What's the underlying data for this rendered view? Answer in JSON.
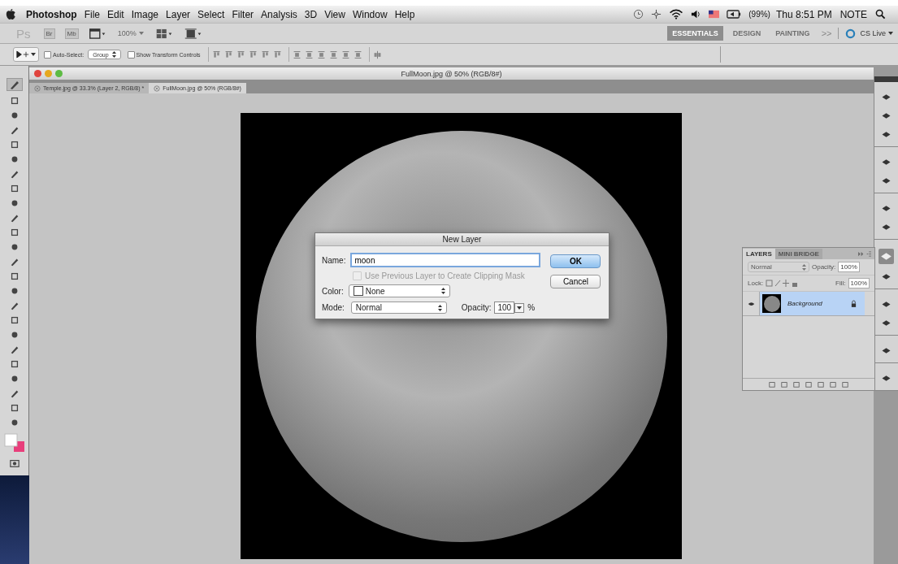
{
  "menubar": {
    "app": "Photoshop",
    "menus": [
      "File",
      "Edit",
      "Image",
      "Layer",
      "Select",
      "Filter",
      "Analysis",
      "3D",
      "View",
      "Window",
      "Help"
    ],
    "battery": "(99%)",
    "clock": "Thu 8:51 PM",
    "user": "NOTE"
  },
  "app_bar": {
    "logo": "Ps",
    "bridge": "Br",
    "mini_bridge": "Mb",
    "zoom": "100%",
    "workspaces": [
      {
        "label": "ESSENTIALS",
        "selected": true
      },
      {
        "label": "DESIGN",
        "selected": false
      },
      {
        "label": "PAINTING",
        "selected": false
      }
    ],
    "more": ">>",
    "cs_live": "CS Live"
  },
  "options_bar": {
    "auto_select": {
      "label": "Auto-Select:",
      "checked": false
    },
    "auto_select_target": "Group",
    "transform_controls": {
      "label": "Show Transform Controls",
      "checked": false
    }
  },
  "document": {
    "title": "FullMoon.jpg @ 50% (RGB/8#)",
    "tabs": [
      {
        "label": "Temple.jpg @ 33.3% (Layer 2, RGB/8) *",
        "selected": false
      },
      {
        "label": "FullMoon.jpg @ 50% (RGB/8#)",
        "selected": true
      }
    ]
  },
  "dock": {
    "items": [
      {
        "selected": false
      },
      {
        "selected": false
      },
      {
        "selected": false
      },
      {
        "selected": false
      },
      {
        "selected": false
      },
      {
        "selected": false
      },
      {
        "selected": false
      },
      {
        "selected": true
      },
      {
        "selected": false
      },
      {
        "selected": false
      },
      {
        "selected": false
      },
      {
        "selected": false
      },
      {
        "selected": false
      }
    ]
  },
  "dialog": {
    "title": "New Layer",
    "name_label": "Name:",
    "name_value": "moon",
    "clipping": {
      "label": "Use Previous Layer to Create Clipping Mask",
      "checked": false,
      "disabled": true
    },
    "color_label": "Color:",
    "color_value": "None",
    "mode_label": "Mode:",
    "mode_value": "Normal",
    "opacity_label": "Opacity:",
    "opacity_value": "100",
    "percent": "%",
    "buttons": [
      {
        "label": "OK",
        "default": true
      },
      {
        "label": "Cancel",
        "default": false
      }
    ]
  },
  "layers_panel": {
    "tabs": [
      {
        "label": "LAYERS",
        "selected": true
      },
      {
        "label": "MINI BRIDGE",
        "selected": false
      }
    ],
    "blend_mode": "Normal",
    "opacity_label": "Opacity:",
    "opacity_value": "100%",
    "lock_label": "Lock:",
    "fill_label": "Fill:",
    "fill_value": "100%",
    "layers": [
      {
        "name": "Background",
        "visible": true,
        "selected": true,
        "locked": true
      }
    ]
  }
}
